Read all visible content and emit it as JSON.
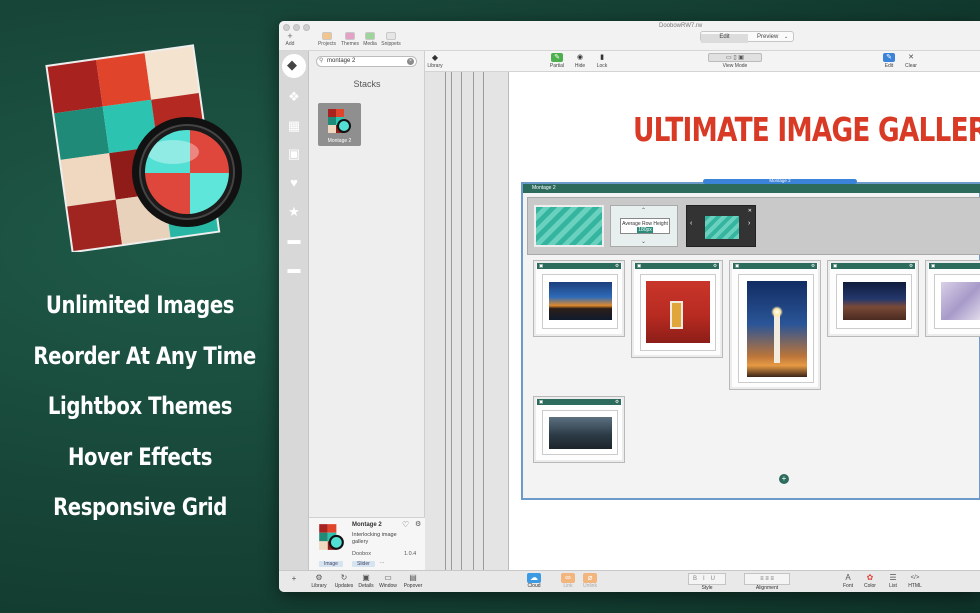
{
  "promo": {
    "features": [
      "Unlimited Images",
      "Reorder At Any Time",
      "Lightbox Themes",
      "Hover Effects",
      "Responsive Grid"
    ]
  },
  "window": {
    "title": "DoobowRW7.rw",
    "toolbar": {
      "add": "Add",
      "projects": "Projects",
      "themes": "Themes",
      "media": "Media",
      "snippets": "Snippets",
      "mode_edit": "Edit",
      "mode_preview": "Preview"
    },
    "toolbar2": {
      "library": "Library",
      "partial": "Partial",
      "hide": "Hide",
      "lock": "Lock",
      "view_mode": "View Mode",
      "edit": "Edit",
      "clear": "Clear"
    },
    "library": {
      "search_value": "montage 2",
      "section_title": "Stacks",
      "tile_name": "Montage 2",
      "info": {
        "name": "Montage 2",
        "description": "Interlocking image gallery",
        "author": "Doobox",
        "version": "1.0.4",
        "tags": [
          "Image",
          "Slider",
          "..."
        ]
      }
    },
    "canvas": {
      "headline": "ULTIMATE IMAGE GALLERY",
      "stack_label": "Montage 2",
      "selection_label": "Montage 2",
      "row_height_label": "Average Row Height",
      "row_height_value": "180px",
      "add_symbol": "+"
    },
    "bottombar": {
      "add": "+",
      "library": "Library",
      "updates": "Updates",
      "details": "Details",
      "window": "Window",
      "popover": "Popover",
      "cloud": "Cloud",
      "link": "Link",
      "unlink": "Unlink",
      "bold": "B",
      "italic": "I",
      "underline": "U",
      "style": "Style",
      "alignment": "Alignment",
      "font": "Font",
      "color": "Color",
      "list": "List",
      "html": "HTML"
    }
  },
  "colors": {
    "background": "#164336",
    "headline": "#d83a25",
    "stack_header": "#2d6b5d",
    "selection": "#3b82d9",
    "teal": "#35b4a0"
  }
}
